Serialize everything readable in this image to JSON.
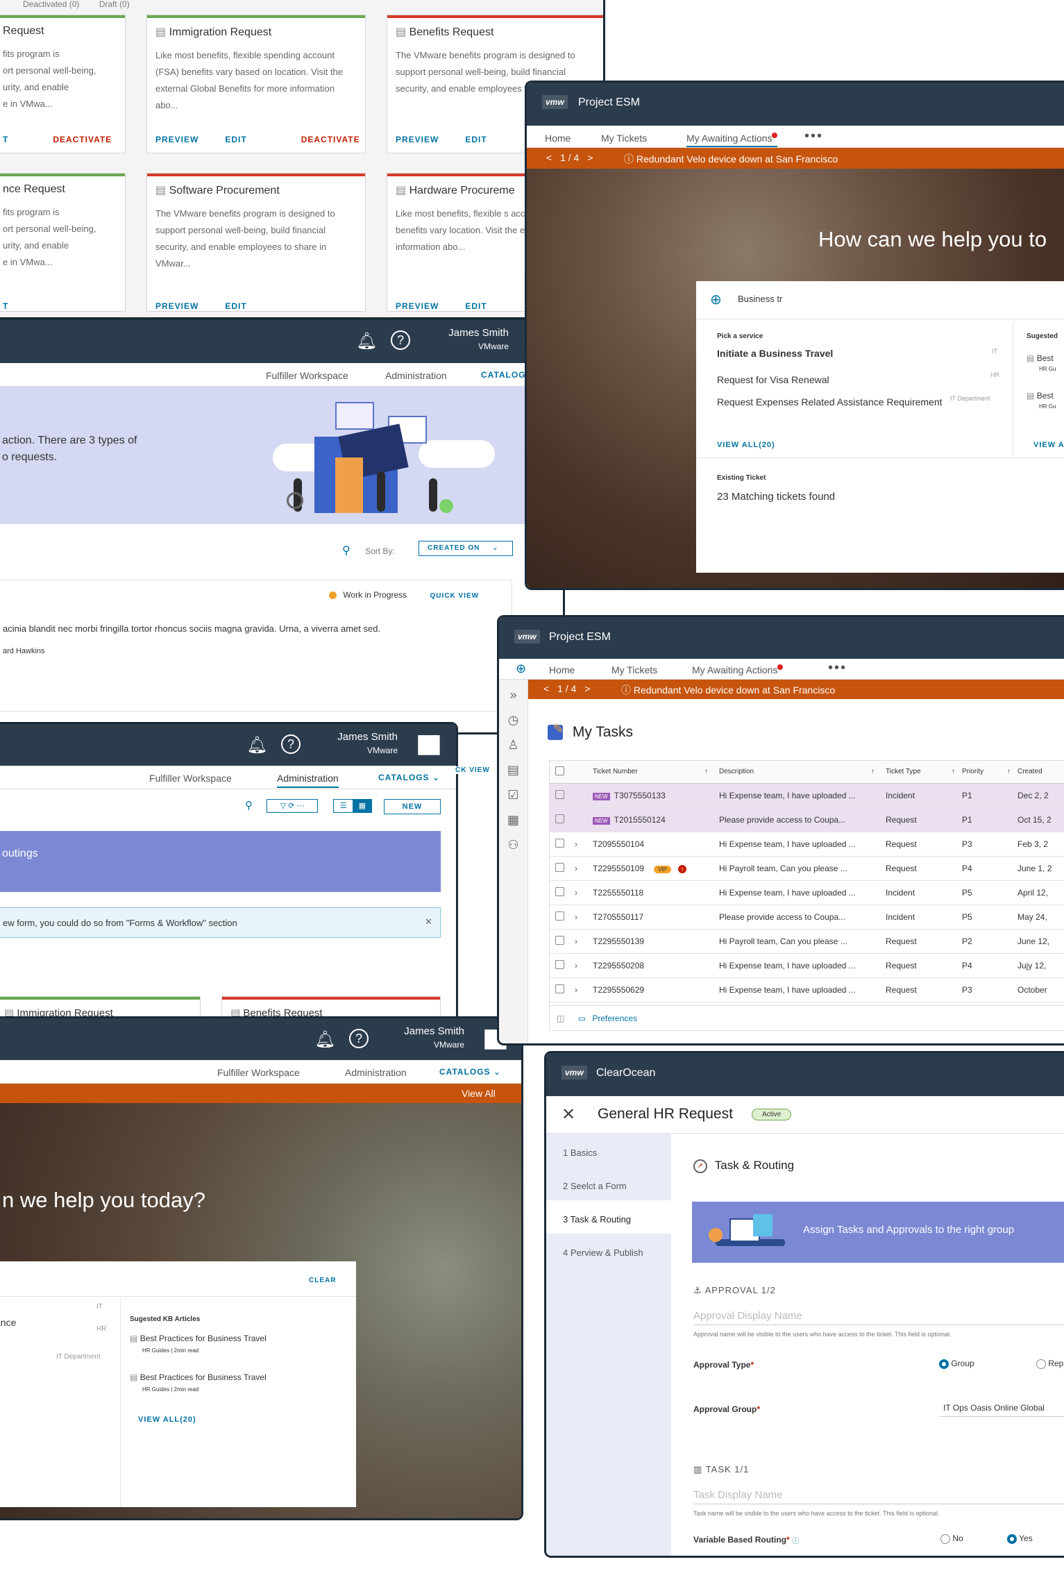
{
  "catalog_top": {
    "tabs": [
      "Deactivated (0)",
      "Draft (0)"
    ],
    "cards": [
      {
        "title": "Request",
        "desc": "fits program is\nort personal well-being,\nurity, and enable\ne in VMwa...",
        "actions": [
          "T",
          "DEACTIVATE"
        ]
      },
      {
        "title": "Immigration Request",
        "desc": "Like most benefits, flexible spending account (FSA) benefits vary based on location. Visit the external Global Benefits for more information abo...",
        "actions": [
          "PREVIEW",
          "EDIT",
          "DEACTIVATE"
        ]
      },
      {
        "title": "Benefits Request",
        "desc": "The VMware benefits program is designed to support personal well-being, build financial security, and enable employees to share in VMw...",
        "actions": [
          "PREVIEW",
          "EDIT"
        ]
      },
      {
        "title": "nce Request",
        "desc": "fits program is\nort personal well-being,\nurity, and enable\ne in VMwa...",
        "actions": [
          "T"
        ]
      },
      {
        "title": "Software Procurement",
        "desc": "The VMware benefits program is designed to support personal well-being, build financial security, and enable employees to share in VMwar...",
        "actions": [
          "PREVIEW",
          "EDIT"
        ]
      },
      {
        "title": "Hardware Procureme",
        "desc": "Like most benefits, flexible s account (FSA) benefits vary location. Visit the external G for more information abo...",
        "actions": [
          "PREVIEW",
          "EDIT"
        ]
      }
    ]
  },
  "user": {
    "name": "James Smith",
    "org": "VMware"
  },
  "nav": {
    "fulfiller": "Fulfiller Workspace",
    "admin": "Administration",
    "catalogs": "CATALOGS"
  },
  "requests_win": {
    "banner_text": "action. There are 3 types of\no requests.",
    "sort_label": "Sort By:",
    "sort_value": "CREATED ON",
    "status": "Work in Progress",
    "quick_view": "QUICK VIEW",
    "body": "acinia blandit nec morbi fringilla tortor rhoncus sociis magna gravida. Urna, a viverra amet sed.",
    "author": "ard Hawkins"
  },
  "routings_win": {
    "new_btn": "NEW",
    "banner": "outings",
    "info": "ew form, you could do so from \"Forms & Workflow\" section",
    "partial_quick_view": "CK VIEW",
    "cards": [
      "Immigration Request",
      "Benefits Request"
    ]
  },
  "help_win_bottom": {
    "view_all": "View All",
    "hero": "n we help you today?",
    "clear": "CLEAR",
    "kb_title": "Sugested KB Articles",
    "tags": [
      "IT",
      "HR",
      "IT Department"
    ],
    "left_word": "ance",
    "articles": [
      {
        "title": "Best Practices for Business Travel",
        "meta": "HR Guides | 2min read"
      },
      {
        "title": "Best Practices for Business Travel",
        "meta": "HR Guides | 2min read"
      }
    ],
    "view_all_kb": "VIEW ALL(20)"
  },
  "esm_top": {
    "app": "Project ESM",
    "logo": "vmw",
    "tabs": [
      "Home",
      "My Tickets",
      "My Awaiting Actions"
    ],
    "pager": "1 / 4",
    "alert": "Redundant Velo device down at San Francisco",
    "hero": "How can we help you to",
    "search_value": "Business tr",
    "pick_label": "Pick a service",
    "services": [
      {
        "name": "Initiate a Business Travel",
        "tag": "IT"
      },
      {
        "name": "Request for Visa Renewal",
        "tag": "HR"
      },
      {
        "name": "Request Expenses Related Assistance Requirement",
        "tag": "IT Department"
      }
    ],
    "view_all": "VIEW ALL(20)",
    "sug_label": "Sugested",
    "sug_items": [
      {
        "title": "Best",
        "meta": "HR Gu"
      },
      {
        "title": "Best",
        "meta": "HR Gu"
      }
    ],
    "sug_view": "VIEW A",
    "existing_label": "Existing Ticket",
    "existing_text": "23 Matching tickets found"
  },
  "esm_tasks": {
    "app": "Project ESM",
    "logo": "vmw",
    "tabs": [
      "Home",
      "My Tickets",
      "My Awaiting Actions"
    ],
    "pager": "1 / 4",
    "alert": "Redundant Velo device down at San Francisco",
    "title": "My Tasks",
    "columns": [
      "Ticket Number",
      "Description",
      "Ticket Type",
      "Priority",
      "Created"
    ],
    "rows": [
      {
        "badge": "NEW",
        "num": "T3075550133",
        "desc": "Hi Expense team, I have uploaded ...",
        "type": "Incident",
        "prio": "P1",
        "created": "Dec 2, 2"
      },
      {
        "badge": "NEW",
        "num": "T2015550124",
        "desc": "Please provide  access to Coupa...",
        "type": "Request",
        "prio": "P1",
        "created": "Oct 15, 2"
      },
      {
        "badge": "",
        "num": "T2095550104",
        "desc": "Hi Expense team, I have uploaded ...",
        "type": "Request",
        "prio": "P3",
        "created": "Feb 3, 2"
      },
      {
        "badge": "",
        "num": "T2295550109",
        "vip": "VIP",
        "desc": "Hi Payroll team, Can you please ...",
        "type": "Request",
        "prio": "P4",
        "created": "June 1, 2"
      },
      {
        "badge": "",
        "num": "T2255550118",
        "desc": "Hi Expense team, I have uploaded ...",
        "type": "Incident",
        "prio": "P5",
        "created": "April 12,"
      },
      {
        "badge": "",
        "num": "T2705550117",
        "desc": "Please provide access to Coupa...",
        "type": "Incident",
        "prio": "P5",
        "created": "May 24,"
      },
      {
        "badge": "",
        "num": "T2295550139",
        "desc": "Hi Payroll team, Can you please ...",
        "type": "Request",
        "prio": "P2",
        "created": "June 12,"
      },
      {
        "badge": "",
        "num": "T2295550208",
        "desc": "Hi Expense team, I have uploaded ...",
        "type": "Request",
        "prio": "P4",
        "created": "Jujy 12,"
      },
      {
        "badge": "",
        "num": "T2295550629",
        "desc": "Hi Expense team, I have uploaded ...",
        "type": "Request",
        "prio": "P3",
        "created": "October"
      }
    ],
    "preferences": "Preferences"
  },
  "hr_form": {
    "app": "ClearOcean",
    "logo": "vmw",
    "title": "General HR Request",
    "status": "Active",
    "steps": [
      "1  Basics",
      "2  Seelct a Form",
      "3  Task & Routing",
      "4  Perview & Publish"
    ],
    "section": "Task & Routing",
    "banner": "Assign Tasks and Approvals to the right group",
    "approval_heading": "APPROVAL 1/2",
    "approval_placeholder": "Approval Display Name",
    "approval_help": "Approval name will be visible to the users who have access to the ticket. This field is optional.",
    "approval_type_label": "Approval Type",
    "opt_group": "Group",
    "opt_rep": "Rep",
    "approval_group_label": "Approval Group",
    "approval_group_value": "IT Ops Oasis Online Global",
    "task_heading": "TASK 1/1",
    "task_placeholder": "Task Display Name",
    "task_help": "Task name will be visible to the users who have access to the ticket. This field is optional.",
    "vbr_label": "Variable Based Routing",
    "opt_no": "No",
    "opt_yes": "Yes"
  }
}
